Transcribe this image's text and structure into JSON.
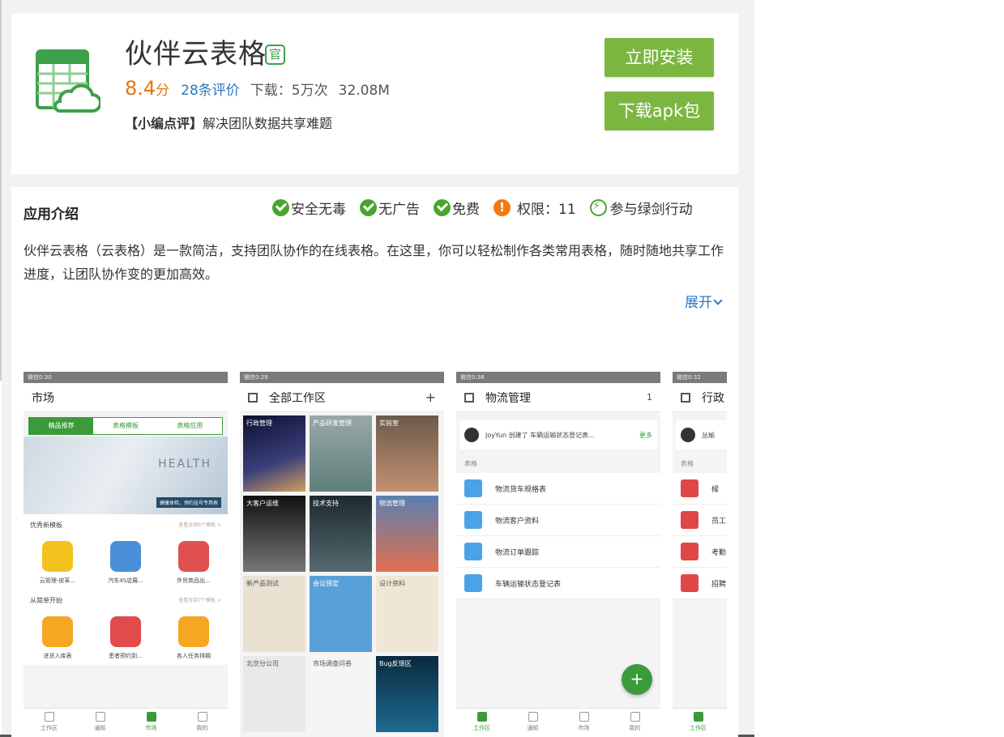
{
  "app": {
    "title": "伙伴云表格",
    "official_badge": "官",
    "score": "8.4",
    "score_unit": "分",
    "reviews": "28条评价",
    "downloads": "下载：5万次",
    "size": "32.08M",
    "editor_tag": "【小编点评】",
    "editor_text": "解决团队数据共享难题"
  },
  "buttons": {
    "install": "立即安装",
    "apk": "下载apk包"
  },
  "intro": {
    "title": "应用介绍",
    "badges": [
      "安全无毒",
      "无广告",
      "免费",
      "权限：11",
      "参与绿剑行动"
    ],
    "description": "伙伴云表格（云表格）是一款简洁，支持团队协作的在线表格。在这里，你可以轻松制作各类常用表格，随时随地共享工作进度，让团队协作变的更加高效。",
    "expand": "展开"
  },
  "shots": {
    "phone1": {
      "status": "微信0:30",
      "title": "市场",
      "segments": [
        "精品推荐",
        "表格模板",
        "表格应用"
      ],
      "banner_text": "HEALTH",
      "banner_caption": "健康体检，预约挂号专用表",
      "section1": "优秀新模板",
      "section1_more": "查看全部8个模板 >",
      "apps1": [
        "云管理-皮革...",
        "汽车4S店展...",
        "外贸商品出..."
      ],
      "section2": "从简单开始",
      "section2_more": "查看全部7个模板 >",
      "apps2": [
        "进货入库表",
        "患者预约到...",
        "各人任务排期"
      ],
      "tabs": [
        "工作区",
        "通知",
        "市场",
        "我的"
      ]
    },
    "phone2": {
      "status": "微信0:29",
      "title": "全部工作区",
      "plus": "+",
      "tiles": [
        "行政管理",
        "产品研发管理",
        "实验室",
        "大客户运维",
        "技术支持",
        "物流管理",
        "新产品测试",
        "会议预定",
        "设计资料",
        "北京分公司",
        "市场调查问卷",
        "Bug反馈区"
      ]
    },
    "phone3": {
      "status": "微信0:38",
      "title": "物流管理",
      "member": "1",
      "activity": "JoyYun 创建了 车辆运输状态登记表...",
      "activity_more": "更多",
      "list_label": "表格",
      "rows": [
        "物流货车规格表",
        "物流客户资料",
        "物流订单跟踪",
        "车辆运输状态登记表"
      ],
      "fab": "+",
      "tabs": [
        "工作区",
        "通知",
        "市场",
        "我的"
      ]
    },
    "phone4": {
      "status": "微信0:32",
      "title": "行政",
      "activity": "丛瑜",
      "list_label": "表格",
      "rows": [
        "候",
        "员工",
        "考勤",
        "招聘"
      ],
      "tabs": [
        "工作区"
      ]
    }
  },
  "colors": {
    "accent_green": "#7bb640",
    "score_orange": "#e8740c",
    "link_blue": "#2b78c0"
  }
}
